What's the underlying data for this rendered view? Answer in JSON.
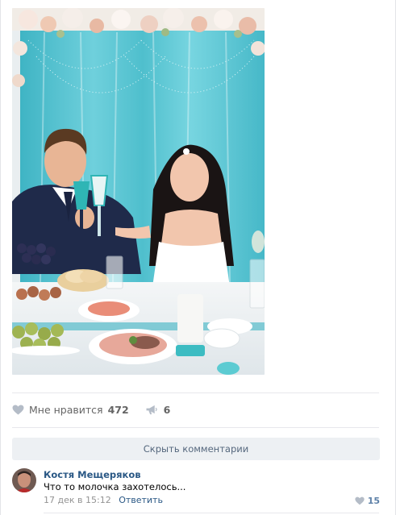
{
  "post": {
    "photo_icon": "wedding-photo",
    "likes": {
      "label": "Мне нравится",
      "count": "472",
      "icon": "heart-icon"
    },
    "shares": {
      "count": "6",
      "icon": "megaphone-icon"
    }
  },
  "comments": {
    "hide_label": "Скрыть комментарии",
    "items": [
      {
        "author": "Костя Мещеряков",
        "text": "Что то молочка захотелось...",
        "date": "17 дек в 15:12",
        "reply_label": "Ответить",
        "likes": "15"
      }
    ]
  },
  "colors": {
    "link": "#2a5885",
    "muted": "#656565",
    "button_bg": "#edf0f3",
    "divider": "#e7e8ec"
  }
}
